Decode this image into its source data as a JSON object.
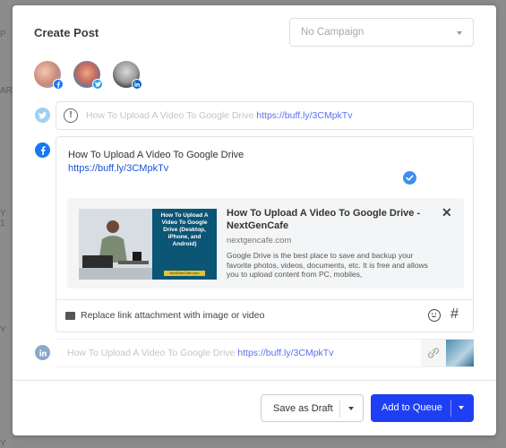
{
  "background": {
    "fragments": [
      "P",
      "AR",
      "Y 1",
      "Y",
      "Y 12"
    ]
  },
  "modal": {
    "title": "Create Post",
    "campaign": {
      "selected": "No Campaign"
    }
  },
  "profiles": [
    {
      "network": "facebook",
      "badge_color": "#1877f2"
    },
    {
      "network": "twitter",
      "badge_color": "#1da1f2"
    },
    {
      "network": "linkedin",
      "badge_color": "#0a66c2"
    }
  ],
  "twitter": {
    "text": "How To Upload A Video To Google Drive",
    "link": "https://buff.ly/3CMpkTv",
    "warning_symbol": "!"
  },
  "facebook": {
    "text": "How To Upload A Video To Google Drive",
    "link": "https://buff.ly/3CMpkTv",
    "preview": {
      "title": "How To Upload A Video To Google Drive - NextGenCafe",
      "domain": "nextgencafe.com",
      "description": "Google Drive is the best place to save and backup your favorite photos, videos, documents, etc. It is free and allows you to upload content from PC, mobiles,",
      "thumbnail_text": "How To Upload A Video To Google Drive (Desktop, iPhone, and Android)",
      "thumbnail_site": "NextGenCafe.com",
      "close_symbol": "✕"
    },
    "replace_label": "Replace link attachment with image or video",
    "hashtag_symbol": "#"
  },
  "linkedin": {
    "text": "How To Upload A Video To Google Drive",
    "link": "https://buff.ly/3CMpkTv"
  },
  "footer": {
    "draft_label": "Save as Draft",
    "queue_label": "Add to Queue"
  },
  "colors": {
    "primary": "#1f3ff4",
    "twitter": "#9fd0f3",
    "facebook": "#1877f2",
    "linkedin": "#8aa8c9",
    "check": "#3c8ff0"
  }
}
